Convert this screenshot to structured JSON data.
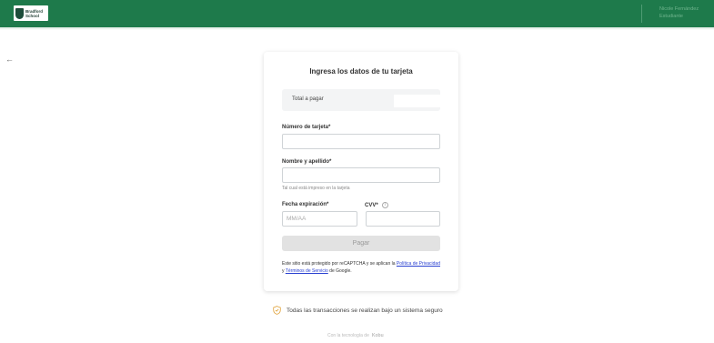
{
  "header": {
    "logo_line1": "Bradford",
    "logo_line2": "School",
    "right_line1": "Nicole Fernández",
    "right_line2": "Estudiante"
  },
  "card": {
    "title": "Ingresa los datos de tu tarjeta",
    "total_label": "Total a pagar",
    "total_value": "",
    "card_number_label": "Número de tarjeta*",
    "card_number_value": "",
    "name_label": "Nombre y apellido*",
    "name_value": "",
    "name_hint": "Tal cual está impreso en la tarjeta",
    "expiry_label": "Fecha expiración*",
    "expiry_placeholder": "MM/AA",
    "cvv_label": "CVV*",
    "cvv_value": "",
    "pay_button": "Pagar",
    "legal_prefix": "Este sitio está protegido por reCAPTCHA y se aplican la ",
    "privacy_link": "Política de Privacidad",
    "legal_middle": " y ",
    "terms_link": "Términos de Servicio",
    "legal_suffix": " de Google."
  },
  "footer": {
    "secure_text": "Todas las transacciones se realizan bajo un sistema seguro",
    "powered_prefix": "Con la tecnología de",
    "powered_brand": "Kobu"
  },
  "colors": {
    "topbar": "#1e7a4b",
    "link": "#2a41d1",
    "shield": "#e0a23a"
  }
}
